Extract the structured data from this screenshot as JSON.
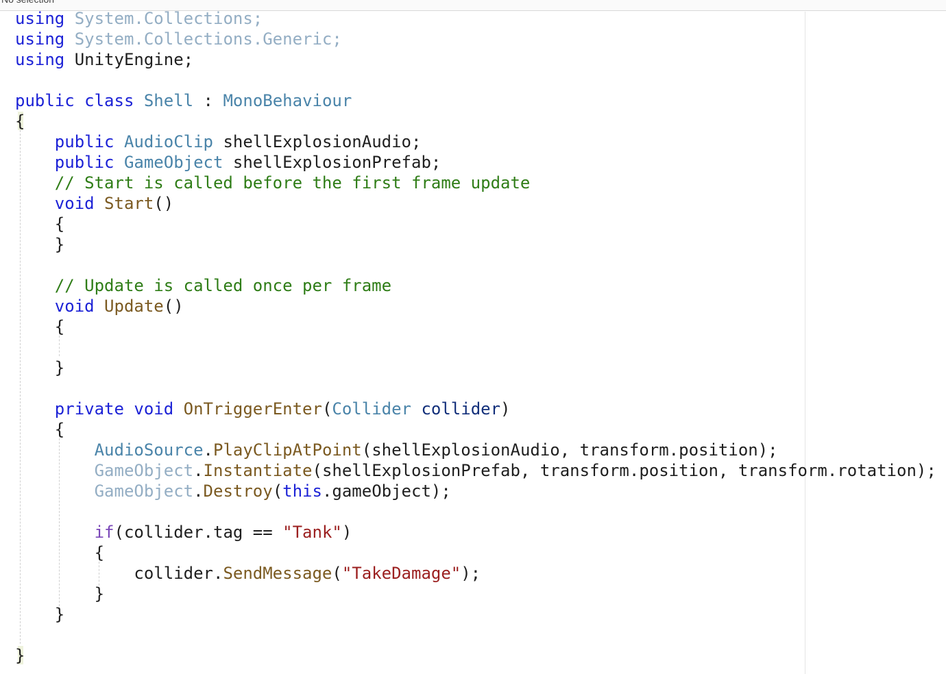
{
  "status_text": "No selection",
  "code": {
    "lines": [
      "using System.Collections;",
      "using System.Collections.Generic;",
      "using UnityEngine;",
      "",
      "public class Shell : MonoBehaviour",
      "{",
      "    public AudioClip shellExplosionAudio;",
      "    public GameObject shellExplosionPrefab;",
      "    // Start is called before the first frame update",
      "    void Start()",
      "    {",
      "    }",
      "",
      "    // Update is called once per frame",
      "    void Update()",
      "    {",
      "",
      "    }",
      "",
      "    private void OnTriggerEnter(Collider collider)",
      "    {",
      "        AudioSource.PlayClipAtPoint(shellExplosionAudio, transform.position);",
      "        GameObject.Instantiate(shellExplosionPrefab, transform.position, transform.rotation);",
      "        GameObject.Destroy(this.gameObject);",
      "",
      "        if(collider.tag == \"Tank\")",
      "        {",
      "            collider.SendMessage(\"TakeDamage\");",
      "        }",
      "    }",
      "",
      "}"
    ]
  },
  "colors": {
    "keyword": "#1c22d6",
    "type": "#4a84a9",
    "method": "#7b5a21",
    "comment": "#2f7d17",
    "string": "#9b1f1f"
  }
}
